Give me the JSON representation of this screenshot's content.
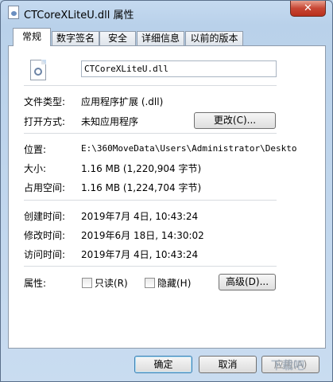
{
  "window": {
    "title": "CTCoreXLiteU.dll 属性",
    "close_label": "✕"
  },
  "tabs": [
    {
      "label": "常规"
    },
    {
      "label": "数字签名"
    },
    {
      "label": "安全"
    },
    {
      "label": "详细信息"
    },
    {
      "label": "以前的版本"
    }
  ],
  "general": {
    "file_name": "CTCoreXLiteU.dll",
    "file_type_label": "文件类型:",
    "file_type_value": "应用程序扩展 (.dll)",
    "open_with_label": "打开方式:",
    "open_with_value": "未知应用程序",
    "change_button": "更改(C)...",
    "location_label": "位置:",
    "location_value": "E:\\360MoveData\\Users\\Administrator\\Deskto",
    "size_label": "大小:",
    "size_value": "1.16 MB (1,220,904 字节)",
    "size_on_disk_label": "占用空间:",
    "size_on_disk_value": "1.16 MB (1,224,704 字节)",
    "created_label": "创建时间:",
    "created_value": "2019年7月 4日, 10:43:24",
    "modified_label": "修改时间:",
    "modified_value": "2019年6月 18日, 14:30:02",
    "accessed_label": "访问时间:",
    "accessed_value": "2019年7月 4日, 10:43:24",
    "attributes_label": "属性:",
    "readonly_label": "只读(R)",
    "hidden_label": "隐藏(H)",
    "advanced_button": "高级(D)..."
  },
  "footer": {
    "ok": "确定",
    "cancel": "取消",
    "apply": "应用(A)"
  },
  "watermark": "下载吧"
}
